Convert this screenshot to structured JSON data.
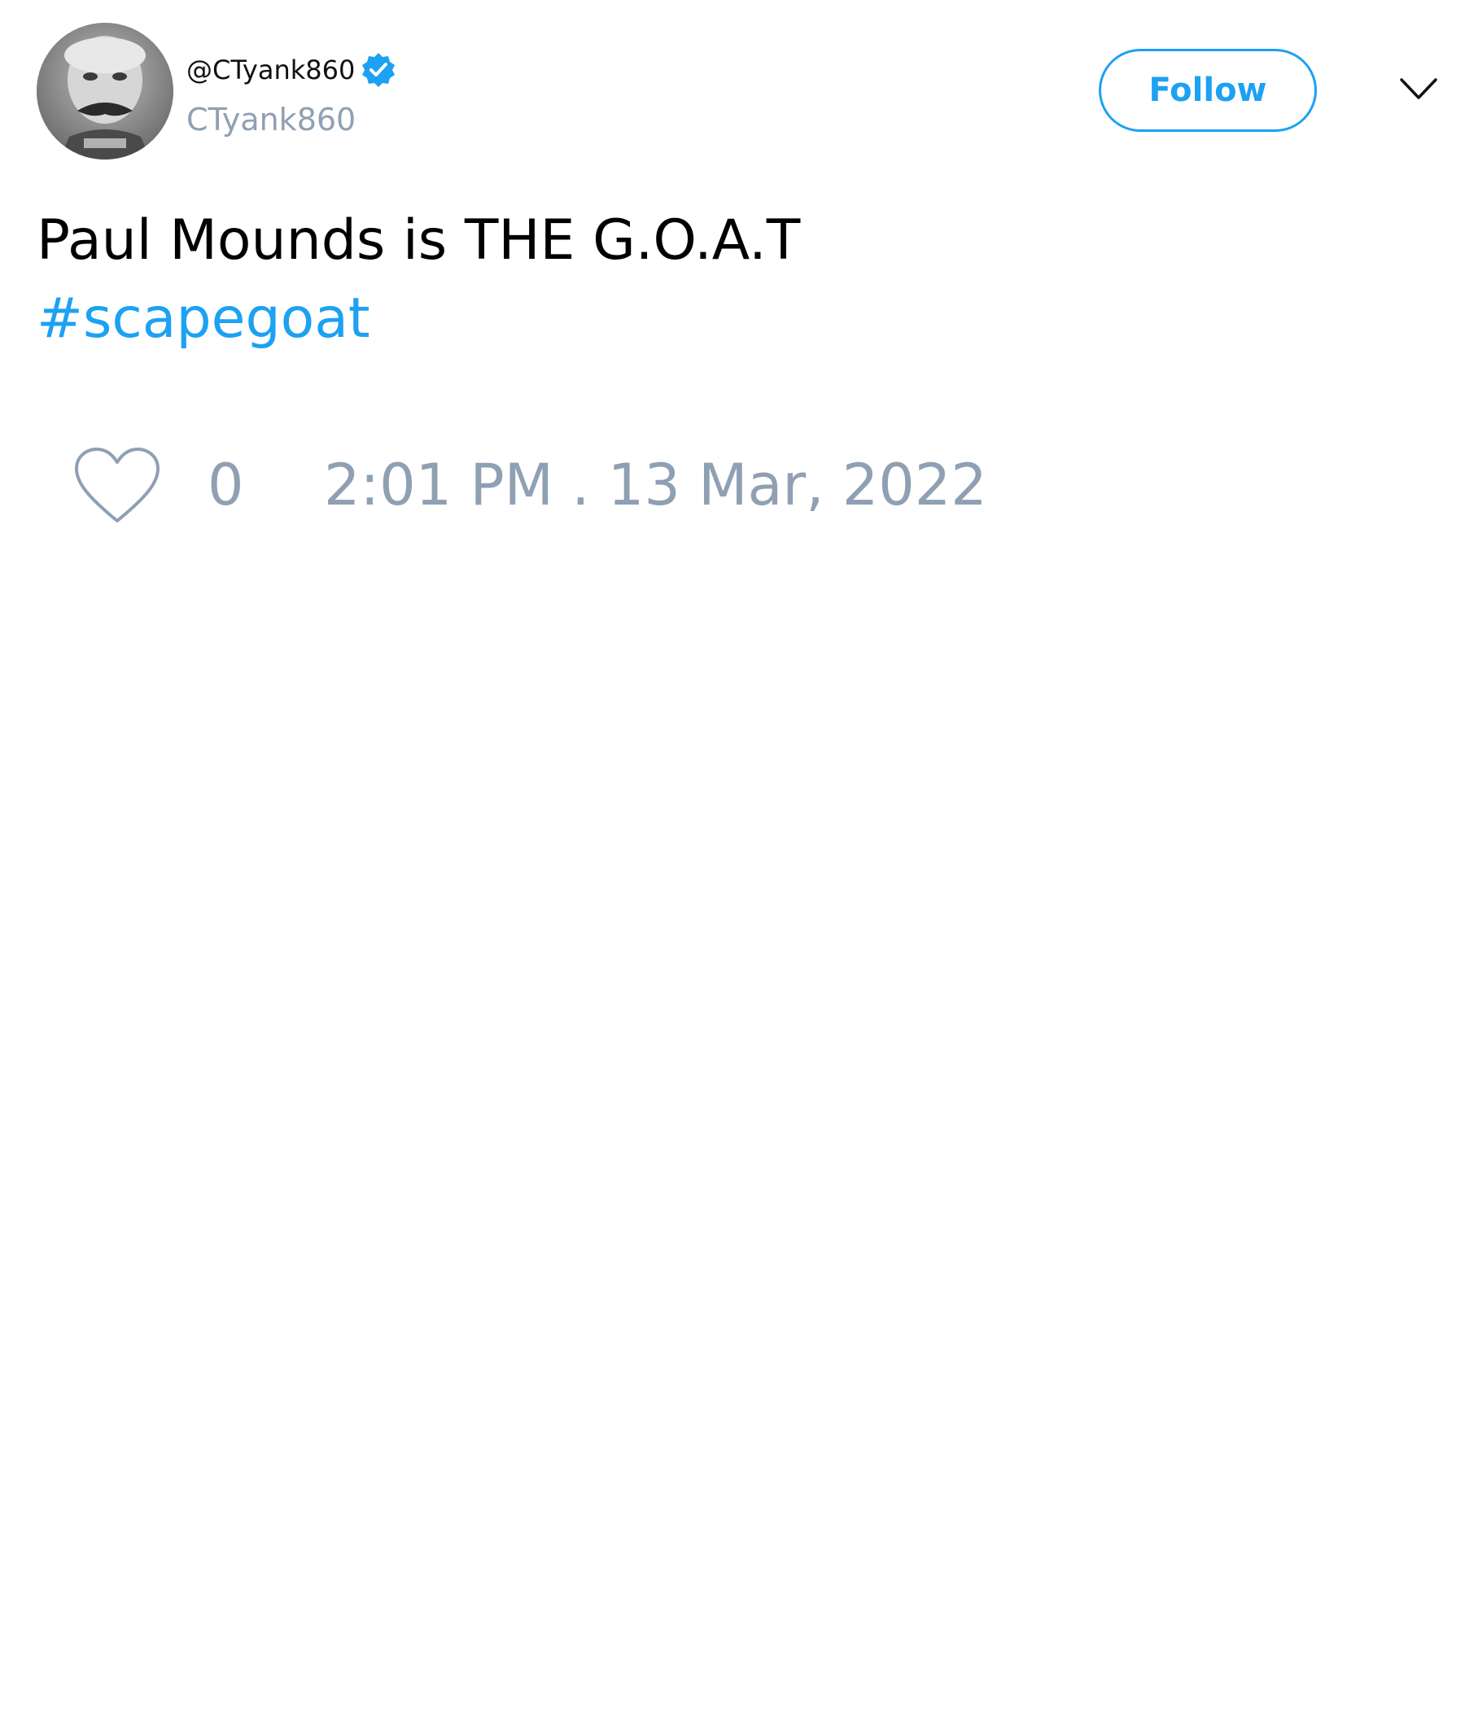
{
  "author": {
    "handle": "@CTyank860",
    "display_name": "CTyank860",
    "verified": true,
    "avatar": "grayscale-portrait-photo"
  },
  "header": {
    "follow_label": "Follow",
    "menu_icon": "chevron-down-icon"
  },
  "tweet": {
    "text": "Paul Mounds is THE G.O.A.T",
    "hashtag": "#scapegoat"
  },
  "footer": {
    "like_icon": "heart-icon",
    "like_count": "0",
    "timestamp": "2:01 PM . 13 Mar, 2022"
  },
  "colors": {
    "accent": "#1da1f2",
    "muted_text": "#8fa0b3",
    "body_text": "#000000",
    "background": "#ffffff"
  }
}
